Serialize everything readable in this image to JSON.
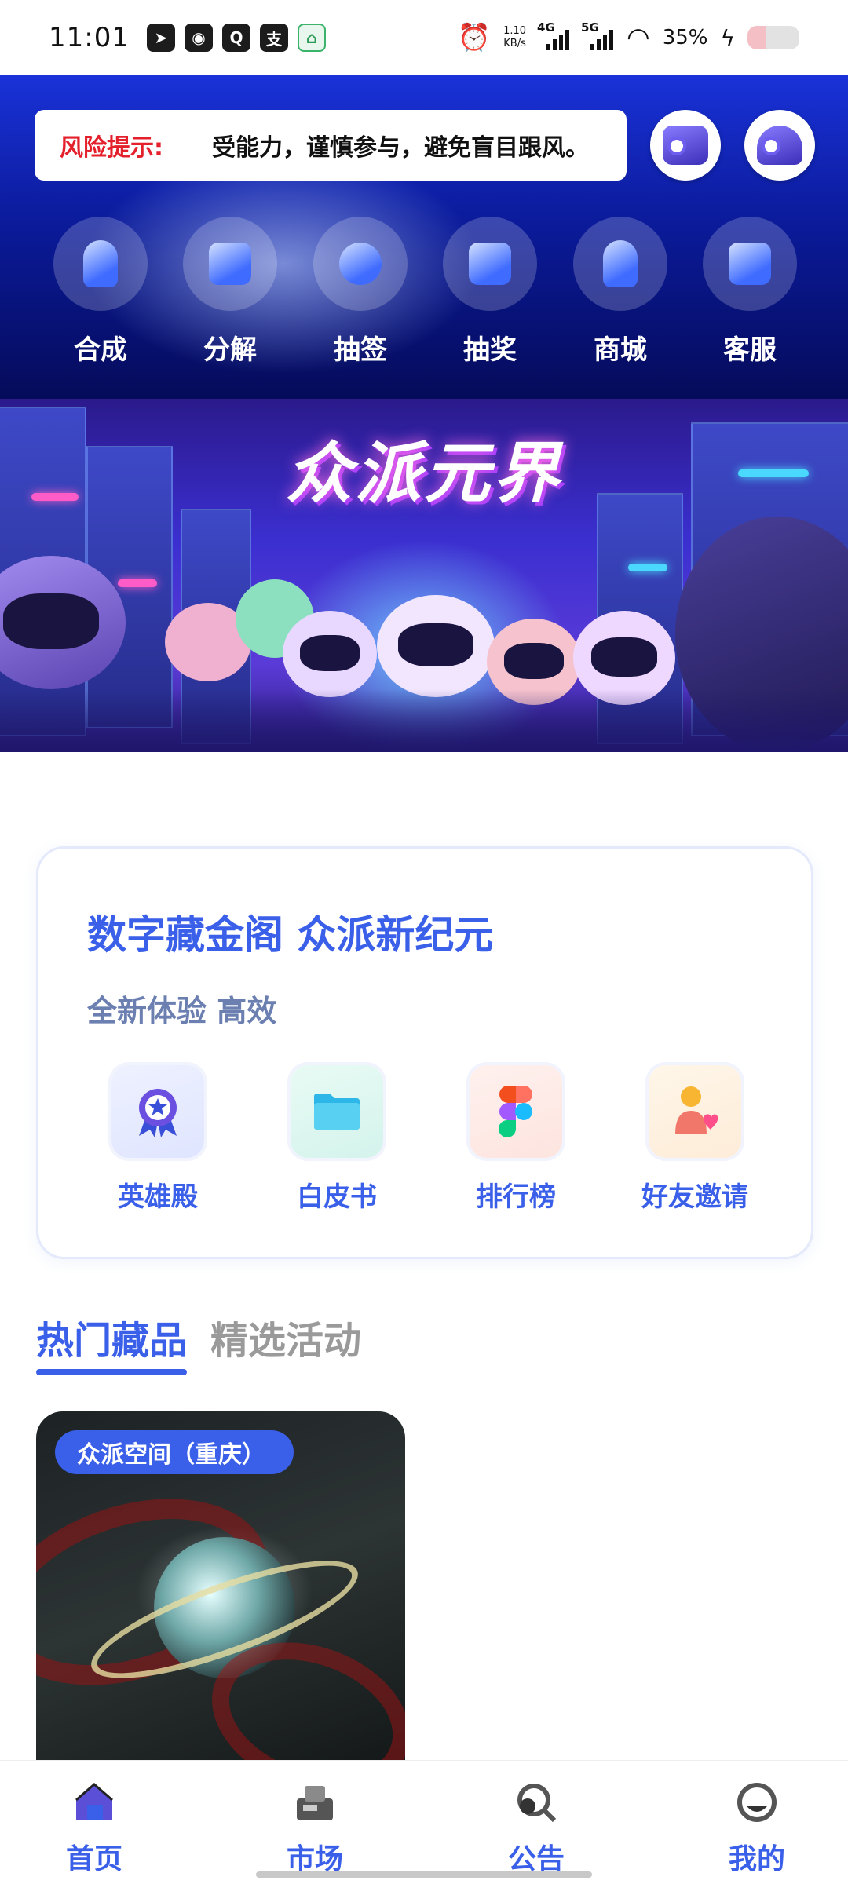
{
  "status_bar": {
    "time": "11:01",
    "app_icons": [
      "telegram-icon",
      "weibo-icon",
      "qq-icon",
      "alipay-icon",
      "home-app-icon"
    ],
    "net_speed_value": "1.10",
    "net_speed_unit": "KB/s",
    "signal_1": "4G",
    "signal_2": "5G",
    "battery": "35%"
  },
  "header": {
    "risk_label": "风险提示:",
    "risk_text": "受能力，谨慎参与，避免盲目跟风。",
    "quick_actions": [
      {
        "label": "合成",
        "icon": "synthesis-icon"
      },
      {
        "label": "分解",
        "icon": "decompose-icon"
      },
      {
        "label": "抽签",
        "icon": "draw-lots-icon"
      },
      {
        "label": "抽奖",
        "icon": "lottery-icon"
      },
      {
        "label": "商城",
        "icon": "mall-icon"
      },
      {
        "label": "客服",
        "icon": "customer-service-icon"
      }
    ]
  },
  "banner": {
    "title": "众派元界"
  },
  "promo": {
    "title": "数字藏金阁 众派新纪元",
    "subtitle": "全新体验 高效",
    "features": [
      {
        "label": "英雄殿",
        "icon": "hero-hall-icon"
      },
      {
        "label": "白皮书",
        "icon": "whitepaper-icon"
      },
      {
        "label": "排行榜",
        "icon": "leaderboard-icon"
      },
      {
        "label": "好友邀请",
        "icon": "invite-friends-icon"
      }
    ]
  },
  "tabs": [
    {
      "label": "热门藏品",
      "active": true
    },
    {
      "label": "精选活动",
      "active": false
    }
  ],
  "collection_card": {
    "tag": "众派空间（重庆）"
  },
  "bottom_nav": [
    {
      "label": "首页",
      "icon": "home-icon"
    },
    {
      "label": "市场",
      "icon": "market-icon"
    },
    {
      "label": "公告",
      "icon": "announcement-icon"
    },
    {
      "label": "我的",
      "icon": "profile-icon"
    }
  ],
  "colors": {
    "accent": "#3a5fe8",
    "risk_red": "#e4202c",
    "header_top": "#1a32d8",
    "header_bottom": "#050b5a"
  }
}
